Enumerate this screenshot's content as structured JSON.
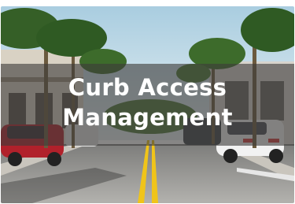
{
  "card": {
    "title_line_1": "Curb Access",
    "title_line_2": "Management"
  },
  "image": {
    "subject": "palm-lined street with parked cars",
    "overlay_color": "#3e3c3a"
  },
  "colors": {
    "sky": "#cfe3ee",
    "road": "#8f8f8f",
    "lane_line": "#f0c419",
    "palm": "#2f5a23",
    "text": "#ffffff"
  }
}
